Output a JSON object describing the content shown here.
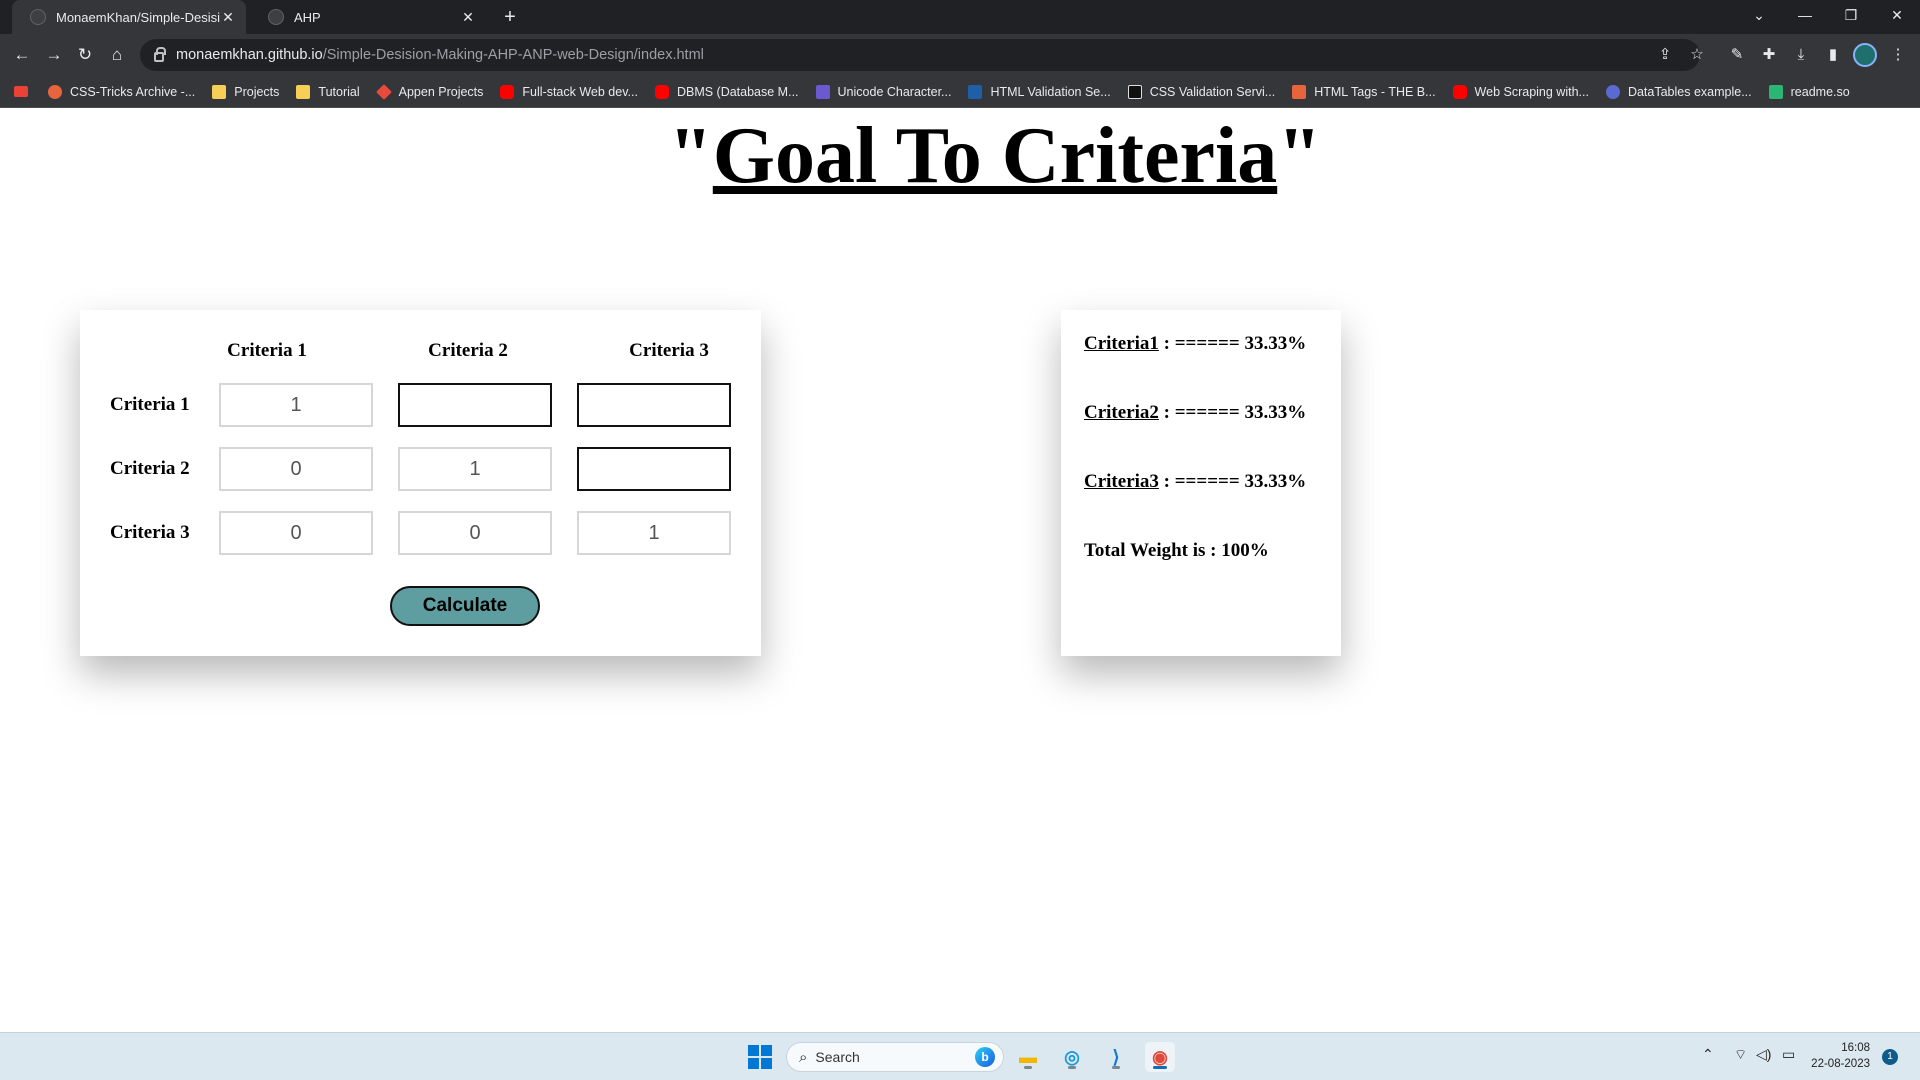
{
  "browser": {
    "tabs": [
      {
        "title": "MonaemKhan/Simple-Desision-M",
        "active": true
      },
      {
        "title": "AHP",
        "active": false
      }
    ],
    "new_tab": "+",
    "url_host": "monaemkhan.github.io",
    "url_path": "/Simple-Desision-Making-AHP-ANP-web-Design/index.html",
    "bookmarks": [
      {
        "label": "CSS-Tricks Archive -...",
        "color": "#e8643c"
      },
      {
        "label": "Projects",
        "color": "#f6cf57"
      },
      {
        "label": "Tutorial",
        "color": "#f6cf57"
      },
      {
        "label": "Appen Projects",
        "color": "#e84a3c"
      },
      {
        "label": "Full-stack Web dev...",
        "color": "#ff0000"
      },
      {
        "label": "DBMS (Database M...",
        "color": "#ff0000"
      },
      {
        "label": "Unicode Character...",
        "color": "#6a5acd"
      },
      {
        "label": "HTML Validation Se...",
        "color": "#1f5fa8"
      },
      {
        "label": "CSS Validation Servi...",
        "color": "#111111"
      },
      {
        "label": "HTML Tags - THE B...",
        "color": "#e8643c"
      },
      {
        "label": "Web Scraping with...",
        "color": "#ff0000"
      },
      {
        "label": "DataTables example...",
        "color": "#5b6ad0"
      },
      {
        "label": "readme.so",
        "color": "#2bb673"
      }
    ]
  },
  "page": {
    "title_open_quote": "\"",
    "title_text": "Goal To Criteria",
    "title_close_quote": "\"",
    "matrix": {
      "column_headers": [
        "Criteria 1",
        "Criteria 2",
        "Criteria 3"
      ],
      "row_headers": [
        "Criteria 1",
        "Criteria 2",
        "Criteria 3"
      ],
      "cells": [
        [
          {
            "value": "1",
            "editable": false
          },
          {
            "value": "",
            "editable": true
          },
          {
            "value": "",
            "editable": true
          }
        ],
        [
          {
            "value": "0",
            "editable": false
          },
          {
            "value": "1",
            "editable": false
          },
          {
            "value": "",
            "editable": true
          }
        ],
        [
          {
            "value": "0",
            "editable": false
          },
          {
            "value": "0",
            "editable": false
          },
          {
            "value": "1",
            "editable": false
          }
        ]
      ],
      "calculate_label": "Calculate",
      "button_color": "#5f9ea0"
    },
    "results": {
      "items": [
        {
          "name": "Criteria1",
          "bar": " : ====== ",
          "value": "33.33%"
        },
        {
          "name": "Criteria2",
          "bar": " : ====== ",
          "value": "33.33%"
        },
        {
          "name": "Criteria3",
          "bar": " : ====== ",
          "value": "33.33%"
        }
      ],
      "total": "Total Weight is : 100%"
    }
  },
  "taskbar": {
    "search_placeholder": "Search",
    "time": "16:08",
    "date": "22-08-2023",
    "notification_count": "1"
  }
}
